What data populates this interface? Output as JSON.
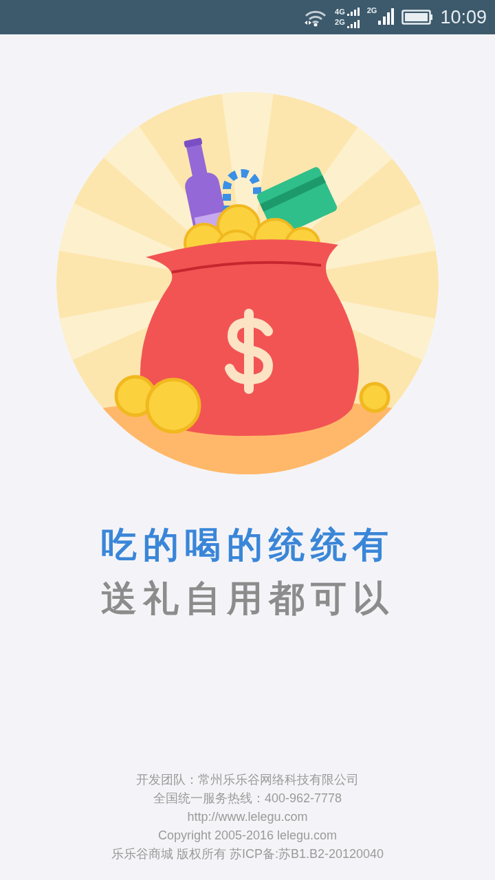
{
  "status_bar": {
    "network_top": "4G",
    "network_bottom": "2G",
    "network_second": "2G",
    "time": "10:09"
  },
  "headline": {
    "primary": "吃的喝的统统有",
    "secondary": "送礼自用都可以"
  },
  "footer": [
    "开发团队：常州乐乐谷网络科技有限公司",
    "全国统一服务热线：400-962-7778",
    "http://www.lelegu.com",
    "Copyright 2005-2016 lelegu.com",
    "乐乐谷商城 版权所有 苏ICP备:苏B1.B2-20120040"
  ]
}
